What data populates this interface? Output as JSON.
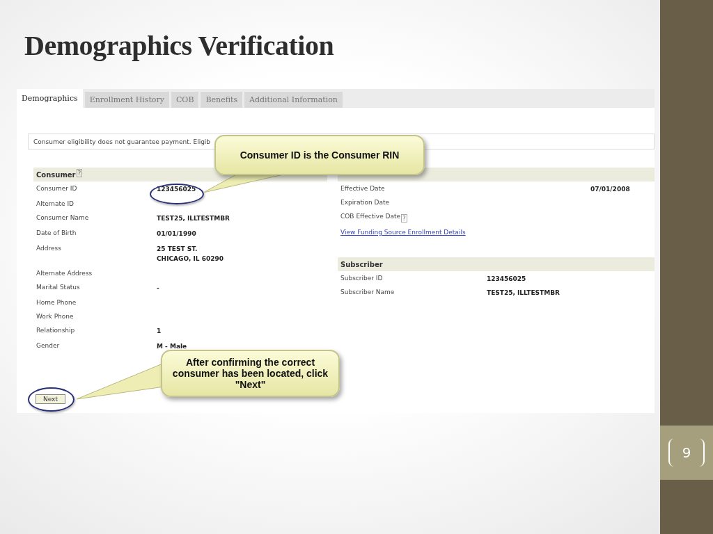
{
  "slide": {
    "title": "Demographics Verification",
    "page_number": "9"
  },
  "tabs": [
    {
      "label": "Demographics",
      "selected": true
    },
    {
      "label": "Enrollment History",
      "selected": false
    },
    {
      "label": "COB",
      "selected": false
    },
    {
      "label": "Benefits",
      "selected": false
    },
    {
      "label": "Additional Information",
      "selected": false
    }
  ],
  "disclaimer": "Consumer eligibility does not guarantee payment. Eligib",
  "consumer": {
    "heading": "Consumer",
    "help": "?",
    "rows": [
      {
        "label": "Consumer ID",
        "value": "123456025"
      },
      {
        "label": "Alternate ID"
      },
      {
        "label": "Consumer Name",
        "value": "TEST25, ILLTESTMBR"
      },
      {
        "label": "Date of Birth",
        "value": "01/01/1990"
      },
      {
        "label": "Address",
        "value": "25 TEST ST.\nCHICAGO, IL 60290"
      },
      {
        "label": "Alternate Address"
      },
      {
        "label": "Marital Status",
        "value": "-"
      },
      {
        "label": "Home Phone"
      },
      {
        "label": "Work Phone"
      },
      {
        "label": "Relationship",
        "value": "1"
      },
      {
        "label": "Gender",
        "value": "M - Male"
      }
    ]
  },
  "eligibility": {
    "rows": [
      {
        "label": "Effective Date",
        "value": "07/01/2008"
      },
      {
        "label": "Expiration Date"
      },
      {
        "label": "COB Effective Date",
        "help": "?"
      }
    ],
    "link": "View Funding Source Enrollment Details"
  },
  "subscriber": {
    "heading": "Subscriber",
    "rows": [
      {
        "label": "Subscriber ID",
        "value": "123456025"
      },
      {
        "label": "Subscriber Name",
        "value": "TEST25, ILLTESTMBR"
      }
    ]
  },
  "next_button": "Next",
  "callouts": [
    {
      "text": "Consumer ID is the Consumer RIN"
    },
    {
      "text": "After confirming the correct consumer has been located, click \"Next\""
    }
  ]
}
